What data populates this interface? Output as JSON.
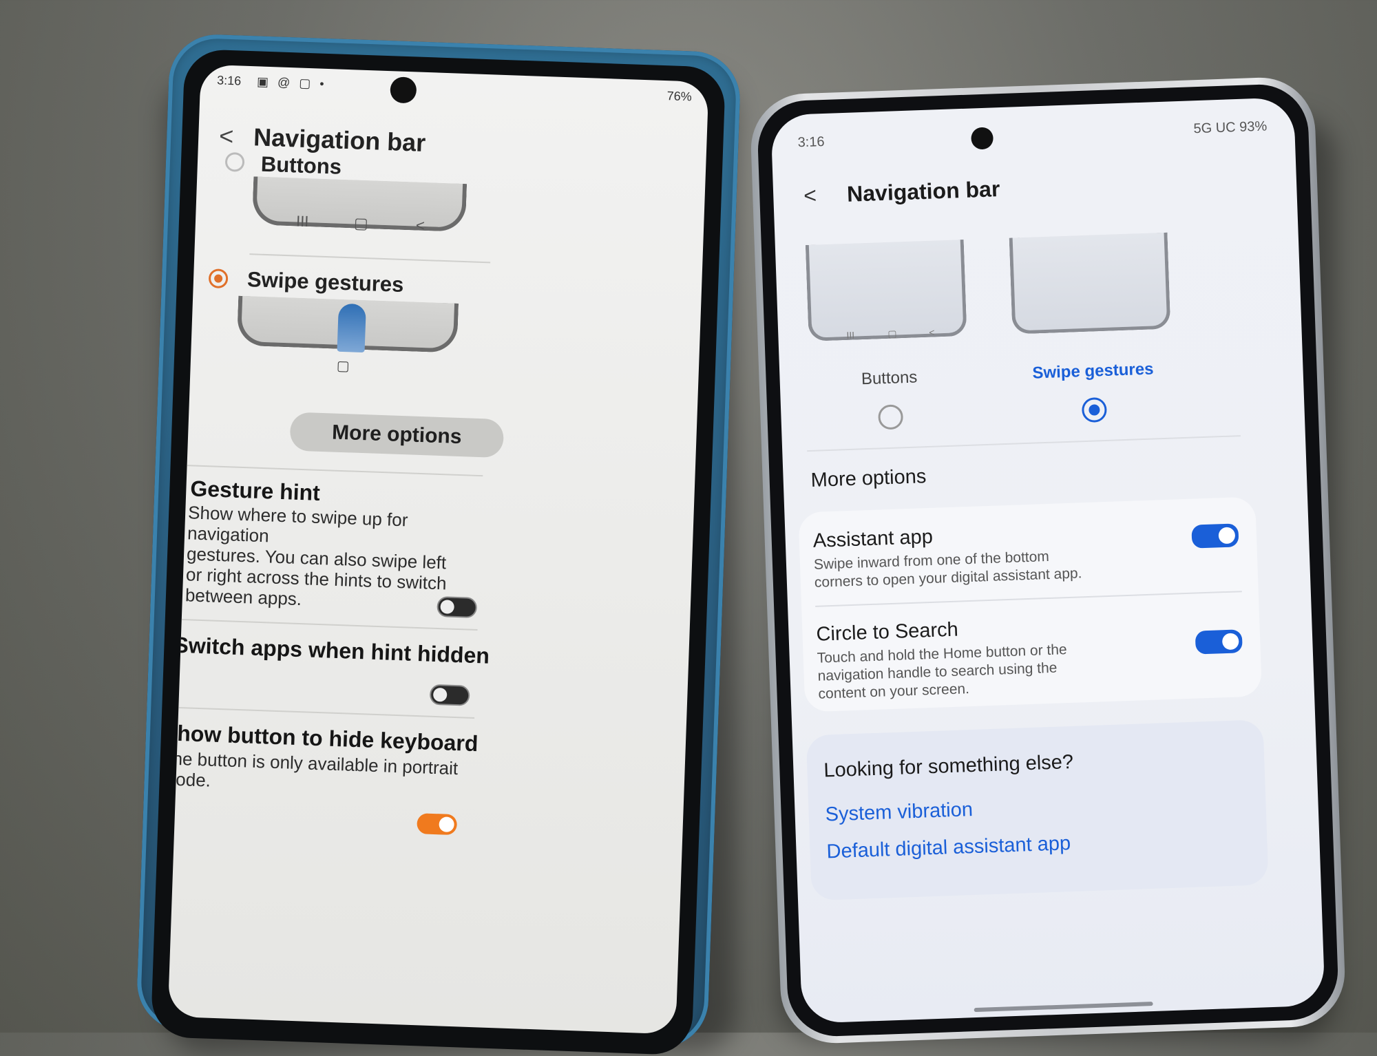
{
  "left_phone": {
    "status": {
      "time": "3:16",
      "notif_icons": "▣ @ ▢ •",
      "right": "76%"
    },
    "header": {
      "back_glyph": "<",
      "title": "Navigation bar"
    },
    "option_buttons": {
      "label": "Buttons",
      "nav_icons": [
        "III",
        "▢",
        "<"
      ]
    },
    "option_gestures": {
      "label": "Swipe gestures",
      "home_icon": "▢"
    },
    "more_options": "More options",
    "gesture_hint": {
      "title": "Gesture hint",
      "desc_lines": [
        "Show where to swipe up for navigation",
        "gestures. You can also swipe left",
        "or right across the hints to switch",
        "between apps."
      ]
    },
    "switch_apps": {
      "title": "Switch apps when hint hidden"
    },
    "hide_keyboard": {
      "title": "Show button to hide keyboard",
      "desc_lines": [
        "The button is only available in portrait",
        "mode."
      ]
    }
  },
  "right_phone": {
    "status": {
      "time": "3:16",
      "right": "5G UC 93%"
    },
    "header": {
      "back_glyph": "<",
      "title": "Navigation bar"
    },
    "option_buttons": {
      "label": "Buttons",
      "nav_icons": [
        "III",
        "▢",
        "<"
      ]
    },
    "option_gestures": {
      "label": "Swipe gestures"
    },
    "more_options": "More options",
    "assistant_app": {
      "title": "Assistant app",
      "desc_lines": [
        "Swipe inward from one of the bottom",
        "corners to open your digital assistant app."
      ]
    },
    "circle_to_search": {
      "title": "Circle to Search",
      "desc_lines": [
        "Touch and hold the Home button or the",
        "navigation handle to search using the",
        "content on your screen."
      ]
    },
    "looking_for": {
      "title": "Looking for something else?",
      "links": [
        "System vibration",
        "Default digital assistant app"
      ]
    }
  },
  "colors": {
    "accent_orange": "#e0702a",
    "accent_blue": "#1a5fd8",
    "case_blue": "#2a5d7f"
  }
}
